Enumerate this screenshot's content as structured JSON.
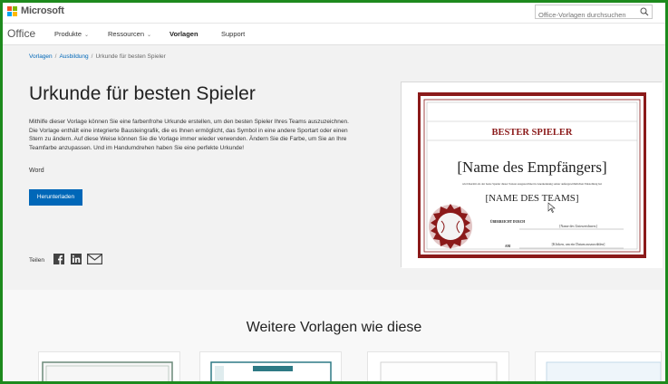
{
  "header": {
    "brand": "Microsoft",
    "search_placeholder": "Office-Vorlagen durchsuchen",
    "brand_colors": [
      "#f25022",
      "#7fba00",
      "#00a4ef",
      "#ffb900"
    ]
  },
  "nav": {
    "product": "Office",
    "items": [
      {
        "label": "Produkte",
        "has_dropdown": true
      },
      {
        "label": "Ressourcen",
        "has_dropdown": true
      },
      {
        "label": "Vorlagen",
        "has_dropdown": false,
        "active": true
      },
      {
        "label": "Support",
        "has_dropdown": false
      }
    ]
  },
  "breadcrumb": {
    "items": [
      "Vorlagen",
      "Ausbildung",
      "Urkunde für besten Spieler"
    ],
    "separator": "/"
  },
  "template": {
    "title": "Urkunde für besten Spieler",
    "description": "Mithilfe dieser Vorlage können Sie eine farbenfrohe Urkunde erstellen, um den besten Spieler Ihres Teams auszuzeichnen. Die Vorlage enthält eine integrierte Bausteingrafik, die es Ihnen ermöglicht, das Symbol in eine andere Sportart oder einen Stern zu ändern. Auf diese Weise können Sie die Vorlage immer wieder verwenden. Ändern Sie die Farbe, um Sie an Ihre Teamfarbe anzupassen. Und im Handumdrehen haben Sie eine perfekte Urkunde!",
    "app": "Word",
    "download_label": "Herunterladen",
    "share_label": "Teilen",
    "share_icons": [
      "facebook-icon",
      "linkedin-icon",
      "mail-icon"
    ]
  },
  "preview": {
    "heading": "BESTER SPIELER",
    "recipient": "[Name des Empfängers]",
    "subtext": "wird hiermit als der beste Spieler dieser Saison ausgezeichnet in Anerkennung seiner außergewöhnlichen Einstellung bei",
    "team": "[NAME DES TEAMS]",
    "presented_by_label": "ÜBERREICHT DURCH",
    "presented_by_value": "[Name des Unterzeichners]",
    "date_label": "AM",
    "date_value": "[Klicken, um ein Datum auszuwählen]",
    "accent_color": "#8b1a1a"
  },
  "more": {
    "title": "Weitere Vorlagen wie diese",
    "card_count": 4
  }
}
